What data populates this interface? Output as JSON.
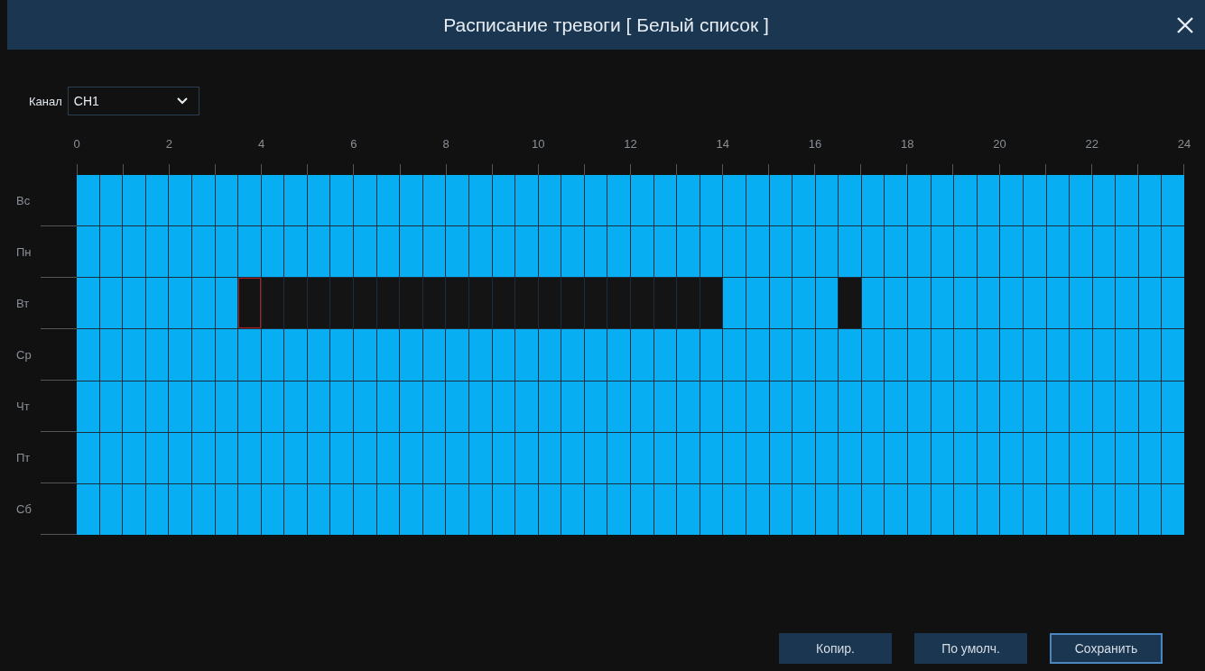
{
  "window": {
    "title": "Расписание тревоги [ Белый список ]"
  },
  "channel": {
    "label": "Канал",
    "value": "CH1"
  },
  "hours": [
    "0",
    "2",
    "4",
    "6",
    "8",
    "10",
    "12",
    "14",
    "16",
    "18",
    "20",
    "22",
    "24"
  ],
  "days": [
    {
      "label": "Вс",
      "cells": [
        {
          "armed": true,
          "focused": false
        },
        {
          "armed": true,
          "focused": false
        },
        {
          "armed": true,
          "focused": false
        },
        {
          "armed": true,
          "focused": false
        },
        {
          "armed": true,
          "focused": false
        },
        {
          "armed": true,
          "focused": false
        },
        {
          "armed": true,
          "focused": false
        },
        {
          "armed": true,
          "focused": false
        },
        {
          "armed": true,
          "focused": false
        },
        {
          "armed": true,
          "focused": false
        },
        {
          "armed": true,
          "focused": false
        },
        {
          "armed": true,
          "focused": false
        },
        {
          "armed": true,
          "focused": false
        },
        {
          "armed": true,
          "focused": false
        },
        {
          "armed": true,
          "focused": false
        },
        {
          "armed": true,
          "focused": false
        },
        {
          "armed": true,
          "focused": false
        },
        {
          "armed": true,
          "focused": false
        },
        {
          "armed": true,
          "focused": false
        },
        {
          "armed": true,
          "focused": false
        },
        {
          "armed": true,
          "focused": false
        },
        {
          "armed": true,
          "focused": false
        },
        {
          "armed": true,
          "focused": false
        },
        {
          "armed": true,
          "focused": false
        },
        {
          "armed": true,
          "focused": false
        },
        {
          "armed": true,
          "focused": false
        },
        {
          "armed": true,
          "focused": false
        },
        {
          "armed": true,
          "focused": false
        },
        {
          "armed": true,
          "focused": false
        },
        {
          "armed": true,
          "focused": false
        },
        {
          "armed": true,
          "focused": false
        },
        {
          "armed": true,
          "focused": false
        },
        {
          "armed": true,
          "focused": false
        },
        {
          "armed": true,
          "focused": false
        },
        {
          "armed": true,
          "focused": false
        },
        {
          "armed": true,
          "focused": false
        },
        {
          "armed": true,
          "focused": false
        },
        {
          "armed": true,
          "focused": false
        },
        {
          "armed": true,
          "focused": false
        },
        {
          "armed": true,
          "focused": false
        },
        {
          "armed": true,
          "focused": false
        },
        {
          "armed": true,
          "focused": false
        },
        {
          "armed": true,
          "focused": false
        },
        {
          "armed": true,
          "focused": false
        },
        {
          "armed": true,
          "focused": false
        },
        {
          "armed": true,
          "focused": false
        },
        {
          "armed": true,
          "focused": false
        },
        {
          "armed": true,
          "focused": false
        }
      ]
    },
    {
      "label": "Пн",
      "cells": [
        {
          "armed": true,
          "focused": false
        },
        {
          "armed": true,
          "focused": false
        },
        {
          "armed": true,
          "focused": false
        },
        {
          "armed": true,
          "focused": false
        },
        {
          "armed": true,
          "focused": false
        },
        {
          "armed": true,
          "focused": false
        },
        {
          "armed": true,
          "focused": false
        },
        {
          "armed": true,
          "focused": false
        },
        {
          "armed": true,
          "focused": false
        },
        {
          "armed": true,
          "focused": false
        },
        {
          "armed": true,
          "focused": false
        },
        {
          "armed": true,
          "focused": false
        },
        {
          "armed": true,
          "focused": false
        },
        {
          "armed": true,
          "focused": false
        },
        {
          "armed": true,
          "focused": false
        },
        {
          "armed": true,
          "focused": false
        },
        {
          "armed": true,
          "focused": false
        },
        {
          "armed": true,
          "focused": false
        },
        {
          "armed": true,
          "focused": false
        },
        {
          "armed": true,
          "focused": false
        },
        {
          "armed": true,
          "focused": false
        },
        {
          "armed": true,
          "focused": false
        },
        {
          "armed": true,
          "focused": false
        },
        {
          "armed": true,
          "focused": false
        },
        {
          "armed": true,
          "focused": false
        },
        {
          "armed": true,
          "focused": false
        },
        {
          "armed": true,
          "focused": false
        },
        {
          "armed": true,
          "focused": false
        },
        {
          "armed": true,
          "focused": false
        },
        {
          "armed": true,
          "focused": false
        },
        {
          "armed": true,
          "focused": false
        },
        {
          "armed": true,
          "focused": false
        },
        {
          "armed": true,
          "focused": false
        },
        {
          "armed": true,
          "focused": false
        },
        {
          "armed": true,
          "focused": false
        },
        {
          "armed": true,
          "focused": false
        },
        {
          "armed": true,
          "focused": false
        },
        {
          "armed": true,
          "focused": false
        },
        {
          "armed": true,
          "focused": false
        },
        {
          "armed": true,
          "focused": false
        },
        {
          "armed": true,
          "focused": false
        },
        {
          "armed": true,
          "focused": false
        },
        {
          "armed": true,
          "focused": false
        },
        {
          "armed": true,
          "focused": false
        },
        {
          "armed": true,
          "focused": false
        },
        {
          "armed": true,
          "focused": false
        },
        {
          "armed": true,
          "focused": false
        },
        {
          "armed": true,
          "focused": false
        }
      ]
    },
    {
      "label": "Вт",
      "cells": [
        {
          "armed": true,
          "focused": false
        },
        {
          "armed": true,
          "focused": false
        },
        {
          "armed": true,
          "focused": false
        },
        {
          "armed": true,
          "focused": false
        },
        {
          "armed": true,
          "focused": false
        },
        {
          "armed": true,
          "focused": false
        },
        {
          "armed": true,
          "focused": false
        },
        {
          "armed": false,
          "focused": true
        },
        {
          "armed": false,
          "focused": false
        },
        {
          "armed": false,
          "focused": false
        },
        {
          "armed": false,
          "focused": false
        },
        {
          "armed": false,
          "focused": false
        },
        {
          "armed": false,
          "focused": false
        },
        {
          "armed": false,
          "focused": false
        },
        {
          "armed": false,
          "focused": false
        },
        {
          "armed": false,
          "focused": false
        },
        {
          "armed": false,
          "focused": false
        },
        {
          "armed": false,
          "focused": false
        },
        {
          "armed": false,
          "focused": false
        },
        {
          "armed": false,
          "focused": false
        },
        {
          "armed": false,
          "focused": false
        },
        {
          "armed": false,
          "focused": false
        },
        {
          "armed": false,
          "focused": false
        },
        {
          "armed": false,
          "focused": false
        },
        {
          "armed": false,
          "focused": false
        },
        {
          "armed": false,
          "focused": false
        },
        {
          "armed": false,
          "focused": false
        },
        {
          "armed": false,
          "focused": false
        },
        {
          "armed": true,
          "focused": false
        },
        {
          "armed": true,
          "focused": false
        },
        {
          "armed": true,
          "focused": false
        },
        {
          "armed": true,
          "focused": false
        },
        {
          "armed": true,
          "focused": false
        },
        {
          "armed": false,
          "focused": false
        },
        {
          "armed": true,
          "focused": false
        },
        {
          "armed": true,
          "focused": false
        },
        {
          "armed": true,
          "focused": false
        },
        {
          "armed": true,
          "focused": false
        },
        {
          "armed": true,
          "focused": false
        },
        {
          "armed": true,
          "focused": false
        },
        {
          "armed": true,
          "focused": false
        },
        {
          "armed": true,
          "focused": false
        },
        {
          "armed": true,
          "focused": false
        },
        {
          "armed": true,
          "focused": false
        },
        {
          "armed": true,
          "focused": false
        },
        {
          "armed": true,
          "focused": false
        },
        {
          "armed": true,
          "focused": false
        },
        {
          "armed": true,
          "focused": false
        }
      ]
    },
    {
      "label": "Ср",
      "cells": [
        {
          "armed": true,
          "focused": false
        },
        {
          "armed": true,
          "focused": false
        },
        {
          "armed": true,
          "focused": false
        },
        {
          "armed": true,
          "focused": false
        },
        {
          "armed": true,
          "focused": false
        },
        {
          "armed": true,
          "focused": false
        },
        {
          "armed": true,
          "focused": false
        },
        {
          "armed": true,
          "focused": false
        },
        {
          "armed": true,
          "focused": false
        },
        {
          "armed": true,
          "focused": false
        },
        {
          "armed": true,
          "focused": false
        },
        {
          "armed": true,
          "focused": false
        },
        {
          "armed": true,
          "focused": false
        },
        {
          "armed": true,
          "focused": false
        },
        {
          "armed": true,
          "focused": false
        },
        {
          "armed": true,
          "focused": false
        },
        {
          "armed": true,
          "focused": false
        },
        {
          "armed": true,
          "focused": false
        },
        {
          "armed": true,
          "focused": false
        },
        {
          "armed": true,
          "focused": false
        },
        {
          "armed": true,
          "focused": false
        },
        {
          "armed": true,
          "focused": false
        },
        {
          "armed": true,
          "focused": false
        },
        {
          "armed": true,
          "focused": false
        },
        {
          "armed": true,
          "focused": false
        },
        {
          "armed": true,
          "focused": false
        },
        {
          "armed": true,
          "focused": false
        },
        {
          "armed": true,
          "focused": false
        },
        {
          "armed": true,
          "focused": false
        },
        {
          "armed": true,
          "focused": false
        },
        {
          "armed": true,
          "focused": false
        },
        {
          "armed": true,
          "focused": false
        },
        {
          "armed": true,
          "focused": false
        },
        {
          "armed": true,
          "focused": false
        },
        {
          "armed": true,
          "focused": false
        },
        {
          "armed": true,
          "focused": false
        },
        {
          "armed": true,
          "focused": false
        },
        {
          "armed": true,
          "focused": false
        },
        {
          "armed": true,
          "focused": false
        },
        {
          "armed": true,
          "focused": false
        },
        {
          "armed": true,
          "focused": false
        },
        {
          "armed": true,
          "focused": false
        },
        {
          "armed": true,
          "focused": false
        },
        {
          "armed": true,
          "focused": false
        },
        {
          "armed": true,
          "focused": false
        },
        {
          "armed": true,
          "focused": false
        },
        {
          "armed": true,
          "focused": false
        },
        {
          "armed": true,
          "focused": false
        }
      ]
    },
    {
      "label": "Чт",
      "cells": [
        {
          "armed": true,
          "focused": false
        },
        {
          "armed": true,
          "focused": false
        },
        {
          "armed": true,
          "focused": false
        },
        {
          "armed": true,
          "focused": false
        },
        {
          "armed": true,
          "focused": false
        },
        {
          "armed": true,
          "focused": false
        },
        {
          "armed": true,
          "focused": false
        },
        {
          "armed": true,
          "focused": false
        },
        {
          "armed": true,
          "focused": false
        },
        {
          "armed": true,
          "focused": false
        },
        {
          "armed": true,
          "focused": false
        },
        {
          "armed": true,
          "focused": false
        },
        {
          "armed": true,
          "focused": false
        },
        {
          "armed": true,
          "focused": false
        },
        {
          "armed": true,
          "focused": false
        },
        {
          "armed": true,
          "focused": false
        },
        {
          "armed": true,
          "focused": false
        },
        {
          "armed": true,
          "focused": false
        },
        {
          "armed": true,
          "focused": false
        },
        {
          "armed": true,
          "focused": false
        },
        {
          "armed": true,
          "focused": false
        },
        {
          "armed": true,
          "focused": false
        },
        {
          "armed": true,
          "focused": false
        },
        {
          "armed": true,
          "focused": false
        },
        {
          "armed": true,
          "focused": false
        },
        {
          "armed": true,
          "focused": false
        },
        {
          "armed": true,
          "focused": false
        },
        {
          "armed": true,
          "focused": false
        },
        {
          "armed": true,
          "focused": false
        },
        {
          "armed": true,
          "focused": false
        },
        {
          "armed": true,
          "focused": false
        },
        {
          "armed": true,
          "focused": false
        },
        {
          "armed": true,
          "focused": false
        },
        {
          "armed": true,
          "focused": false
        },
        {
          "armed": true,
          "focused": false
        },
        {
          "armed": true,
          "focused": false
        },
        {
          "armed": true,
          "focused": false
        },
        {
          "armed": true,
          "focused": false
        },
        {
          "armed": true,
          "focused": false
        },
        {
          "armed": true,
          "focused": false
        },
        {
          "armed": true,
          "focused": false
        },
        {
          "armed": true,
          "focused": false
        },
        {
          "armed": true,
          "focused": false
        },
        {
          "armed": true,
          "focused": false
        },
        {
          "armed": true,
          "focused": false
        },
        {
          "armed": true,
          "focused": false
        },
        {
          "armed": true,
          "focused": false
        },
        {
          "armed": true,
          "focused": false
        }
      ]
    },
    {
      "label": "Пт",
      "cells": [
        {
          "armed": true,
          "focused": false
        },
        {
          "armed": true,
          "focused": false
        },
        {
          "armed": true,
          "focused": false
        },
        {
          "armed": true,
          "focused": false
        },
        {
          "armed": true,
          "focused": false
        },
        {
          "armed": true,
          "focused": false
        },
        {
          "armed": true,
          "focused": false
        },
        {
          "armed": true,
          "focused": false
        },
        {
          "armed": true,
          "focused": false
        },
        {
          "armed": true,
          "focused": false
        },
        {
          "armed": true,
          "focused": false
        },
        {
          "armed": true,
          "focused": false
        },
        {
          "armed": true,
          "focused": false
        },
        {
          "armed": true,
          "focused": false
        },
        {
          "armed": true,
          "focused": false
        },
        {
          "armed": true,
          "focused": false
        },
        {
          "armed": true,
          "focused": false
        },
        {
          "armed": true,
          "focused": false
        },
        {
          "armed": true,
          "focused": false
        },
        {
          "armed": true,
          "focused": false
        },
        {
          "armed": true,
          "focused": false
        },
        {
          "armed": true,
          "focused": false
        },
        {
          "armed": true,
          "focused": false
        },
        {
          "armed": true,
          "focused": false
        },
        {
          "armed": true,
          "focused": false
        },
        {
          "armed": true,
          "focused": false
        },
        {
          "armed": true,
          "focused": false
        },
        {
          "armed": true,
          "focused": false
        },
        {
          "armed": true,
          "focused": false
        },
        {
          "armed": true,
          "focused": false
        },
        {
          "armed": true,
          "focused": false
        },
        {
          "armed": true,
          "focused": false
        },
        {
          "armed": true,
          "focused": false
        },
        {
          "armed": true,
          "focused": false
        },
        {
          "armed": true,
          "focused": false
        },
        {
          "armed": true,
          "focused": false
        },
        {
          "armed": true,
          "focused": false
        },
        {
          "armed": true,
          "focused": false
        },
        {
          "armed": true,
          "focused": false
        },
        {
          "armed": true,
          "focused": false
        },
        {
          "armed": true,
          "focused": false
        },
        {
          "armed": true,
          "focused": false
        },
        {
          "armed": true,
          "focused": false
        },
        {
          "armed": true,
          "focused": false
        },
        {
          "armed": true,
          "focused": false
        },
        {
          "armed": true,
          "focused": false
        },
        {
          "armed": true,
          "focused": false
        },
        {
          "armed": true,
          "focused": false
        }
      ]
    },
    {
      "label": "Сб",
      "cells": [
        {
          "armed": true,
          "focused": false
        },
        {
          "armed": true,
          "focused": false
        },
        {
          "armed": true,
          "focused": false
        },
        {
          "armed": true,
          "focused": false
        },
        {
          "armed": true,
          "focused": false
        },
        {
          "armed": true,
          "focused": false
        },
        {
          "armed": true,
          "focused": false
        },
        {
          "armed": true,
          "focused": false
        },
        {
          "armed": true,
          "focused": false
        },
        {
          "armed": true,
          "focused": false
        },
        {
          "armed": true,
          "focused": false
        },
        {
          "armed": true,
          "focused": false
        },
        {
          "armed": true,
          "focused": false
        },
        {
          "armed": true,
          "focused": false
        },
        {
          "armed": true,
          "focused": false
        },
        {
          "armed": true,
          "focused": false
        },
        {
          "armed": true,
          "focused": false
        },
        {
          "armed": true,
          "focused": false
        },
        {
          "armed": true,
          "focused": false
        },
        {
          "armed": true,
          "focused": false
        },
        {
          "armed": true,
          "focused": false
        },
        {
          "armed": true,
          "focused": false
        },
        {
          "armed": true,
          "focused": false
        },
        {
          "armed": true,
          "focused": false
        },
        {
          "armed": true,
          "focused": false
        },
        {
          "armed": true,
          "focused": false
        },
        {
          "armed": true,
          "focused": false
        },
        {
          "armed": true,
          "focused": false
        },
        {
          "armed": true,
          "focused": false
        },
        {
          "armed": true,
          "focused": false
        },
        {
          "armed": true,
          "focused": false
        },
        {
          "armed": true,
          "focused": false
        },
        {
          "armed": true,
          "focused": false
        },
        {
          "armed": true,
          "focused": false
        },
        {
          "armed": true,
          "focused": false
        },
        {
          "armed": true,
          "focused": false
        },
        {
          "armed": true,
          "focused": false
        },
        {
          "armed": true,
          "focused": false
        },
        {
          "armed": true,
          "focused": false
        },
        {
          "armed": true,
          "focused": false
        },
        {
          "armed": true,
          "focused": false
        },
        {
          "armed": true,
          "focused": false
        },
        {
          "armed": true,
          "focused": false
        },
        {
          "armed": true,
          "focused": false
        },
        {
          "armed": true,
          "focused": false
        },
        {
          "armed": true,
          "focused": false
        },
        {
          "armed": true,
          "focused": false
        },
        {
          "armed": true,
          "focused": false
        }
      ]
    }
  ],
  "buttons": [
    {
      "label": "Копир.",
      "focused": false
    },
    {
      "label": "По умолч.",
      "focused": false
    },
    {
      "label": "Сохранить",
      "focused": true
    }
  ]
}
